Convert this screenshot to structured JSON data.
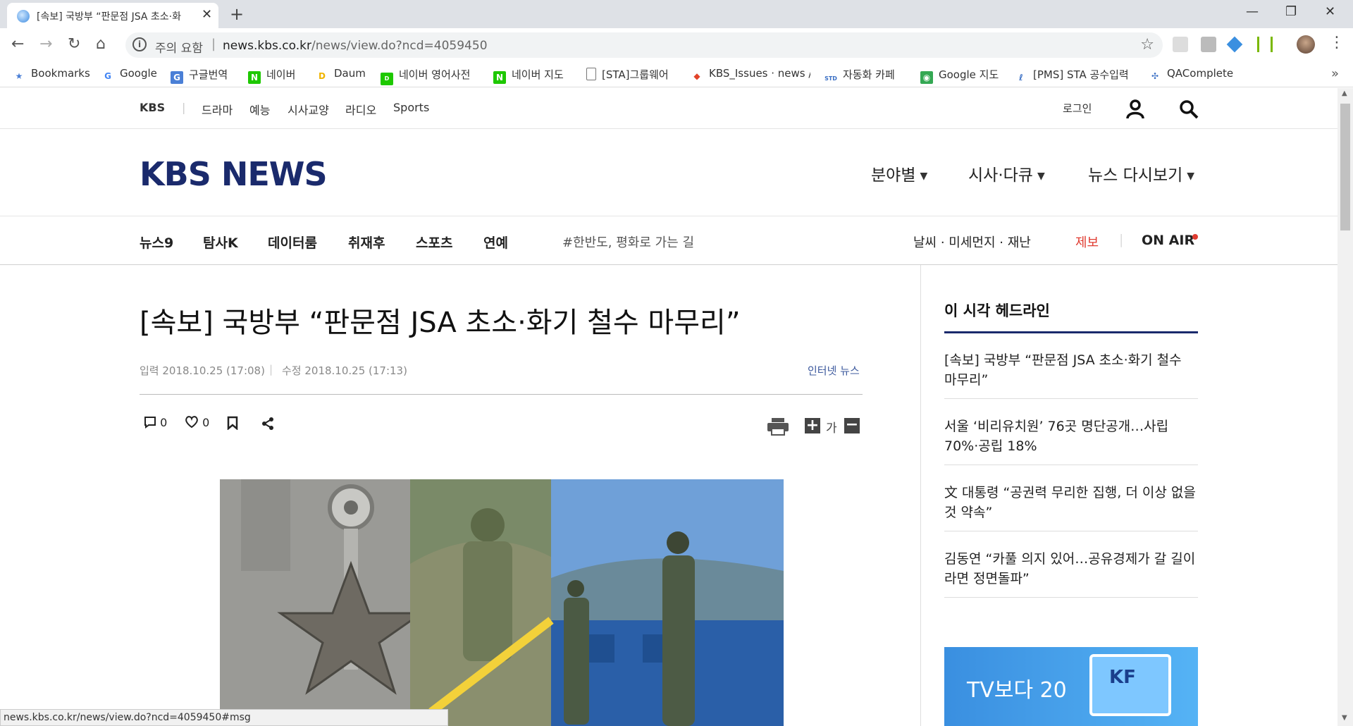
{
  "browser": {
    "tab_title": "[속보] 국방부 “판문점 JSA 초소·화",
    "address_warning": "주의 요함",
    "url_domain": "news.kbs.co.kr",
    "url_path": "/news/view.do?ncd=4059450",
    "bookmarks": [
      {
        "label": "Bookmarks",
        "icon": "star-icon",
        "color": "#4a7fd6"
      },
      {
        "label": "Google",
        "icon": "google-icon",
        "color": "#4285f4"
      },
      {
        "label": "구글번역",
        "icon": "translate-icon",
        "color": "#4a7fd6"
      },
      {
        "label": "네이버",
        "icon": "naver-icon",
        "color": "#1ec800"
      },
      {
        "label": "Daum",
        "icon": "daum-icon",
        "color": "#f0b400"
      },
      {
        "label": "네이버 영어사전",
        "icon": "dict-icon",
        "color": "#1ec800"
      },
      {
        "label": "네이버 지도",
        "icon": "naver-icon",
        "color": "#1ec800"
      },
      {
        "label": "[STA]그룹웨어",
        "icon": "page-icon",
        "color": "#777777"
      },
      {
        "label": "KBS_Issues · news / i",
        "icon": "gitlab-icon",
        "color": "#e24329"
      },
      {
        "label": "자동화 카페",
        "icon": "cafe-icon",
        "color": "#3a6fc4"
      },
      {
        "label": "Google 지도",
        "icon": "maps-icon",
        "color": "#34a853"
      },
      {
        "label": "[PMS] STA 공수입력",
        "icon": "pms-icon",
        "color": "#3a6fc4"
      },
      {
        "label": "QAComplete",
        "icon": "qa-icon",
        "color": "#3a6fc4"
      }
    ],
    "status_url": "news.kbs.co.kr/news/view.do?ncd=4059450#msg"
  },
  "site": {
    "topnav": {
      "brand": "KBS",
      "items": [
        "드라마",
        "예능",
        "시사교양",
        "라디오",
        "Sports"
      ],
      "login": "로그인"
    },
    "logo": "KBS NEWS",
    "main_menu": [
      "분야별",
      "시사·다큐",
      "뉴스 다시보기"
    ],
    "sections": [
      "뉴스9",
      "탐사K",
      "데이터룸",
      "취재후",
      "스포츠",
      "연예"
    ],
    "hashtag": "#한반도, 평화로 가는 길",
    "right_links": {
      "weather": "날씨 · 미세먼지 · 재난",
      "tip": "제보",
      "onair": "ON AIR"
    },
    "colors": {
      "brand_navy": "#1a2a6c",
      "tip_red": "#e03c31",
      "onair_dot": "#e03c31",
      "source_blue": "#3d5a9e"
    }
  },
  "article": {
    "headline": "[속보] 국방부 “판문점 JSA 초소·화기 철수 마무리”",
    "input_time": "입력 2018.10.25 (17:08)",
    "modified_time": "수정 2018.10.25 (17:13)",
    "source": "인터넷 뉴스",
    "comment_count": "0",
    "like_count": "0",
    "font_size_label": "가"
  },
  "sidebar": {
    "title": "이 시각 헤드라인",
    "headlines": [
      "[속보] 국방부 “판문점 JSA 초소·화기 철수 마무리”",
      "서울 ‘비리유치원’ 76곳 명단공개…사립 70%·공립 18%",
      "文 대통령 “공권력 무리한 집행, 더 이상 없을 것 약속”",
      "김동연 “카풀 의지 있어…공유경제가 갈 길이라면 정면돌파”"
    ],
    "banner_text": "TV보다 20",
    "banner_logo": "KF"
  }
}
